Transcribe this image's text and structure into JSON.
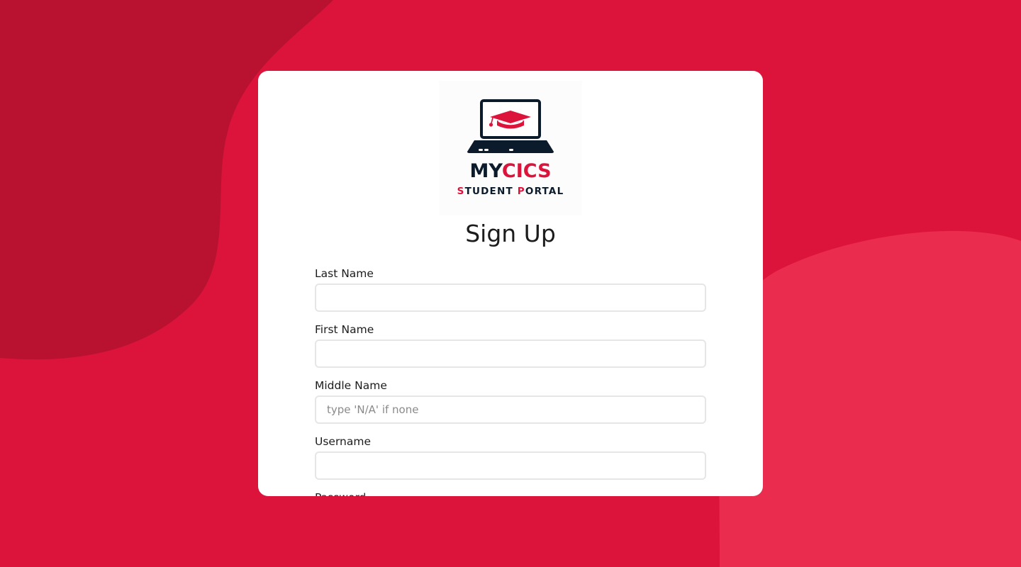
{
  "brand": {
    "line1_a": "MY",
    "line1_b": "CICS",
    "line2_s": "S",
    "line2_a": "TUDENT ",
    "line2_p": "P",
    "line2_b": "ORTAL",
    "logo_icon": "laptop-graduation-cap-icon",
    "primary_color": "#dc143c",
    "dark_color": "#0b1b2b"
  },
  "form": {
    "title": "Sign Up",
    "fields": {
      "last_name": {
        "label": "Last Name",
        "value": "",
        "placeholder": ""
      },
      "first_name": {
        "label": "First Name",
        "value": "",
        "placeholder": ""
      },
      "middle_name": {
        "label": "Middle Name",
        "value": "",
        "placeholder": "type 'N/A' if none"
      },
      "username": {
        "label": "Username",
        "value": "",
        "placeholder": ""
      },
      "password": {
        "label": "Password"
      }
    }
  },
  "theme": {
    "background": "#dc143c",
    "blob_dark": "#b81230",
    "blob_light": "#ea2c4e",
    "card": "#ffffff"
  }
}
